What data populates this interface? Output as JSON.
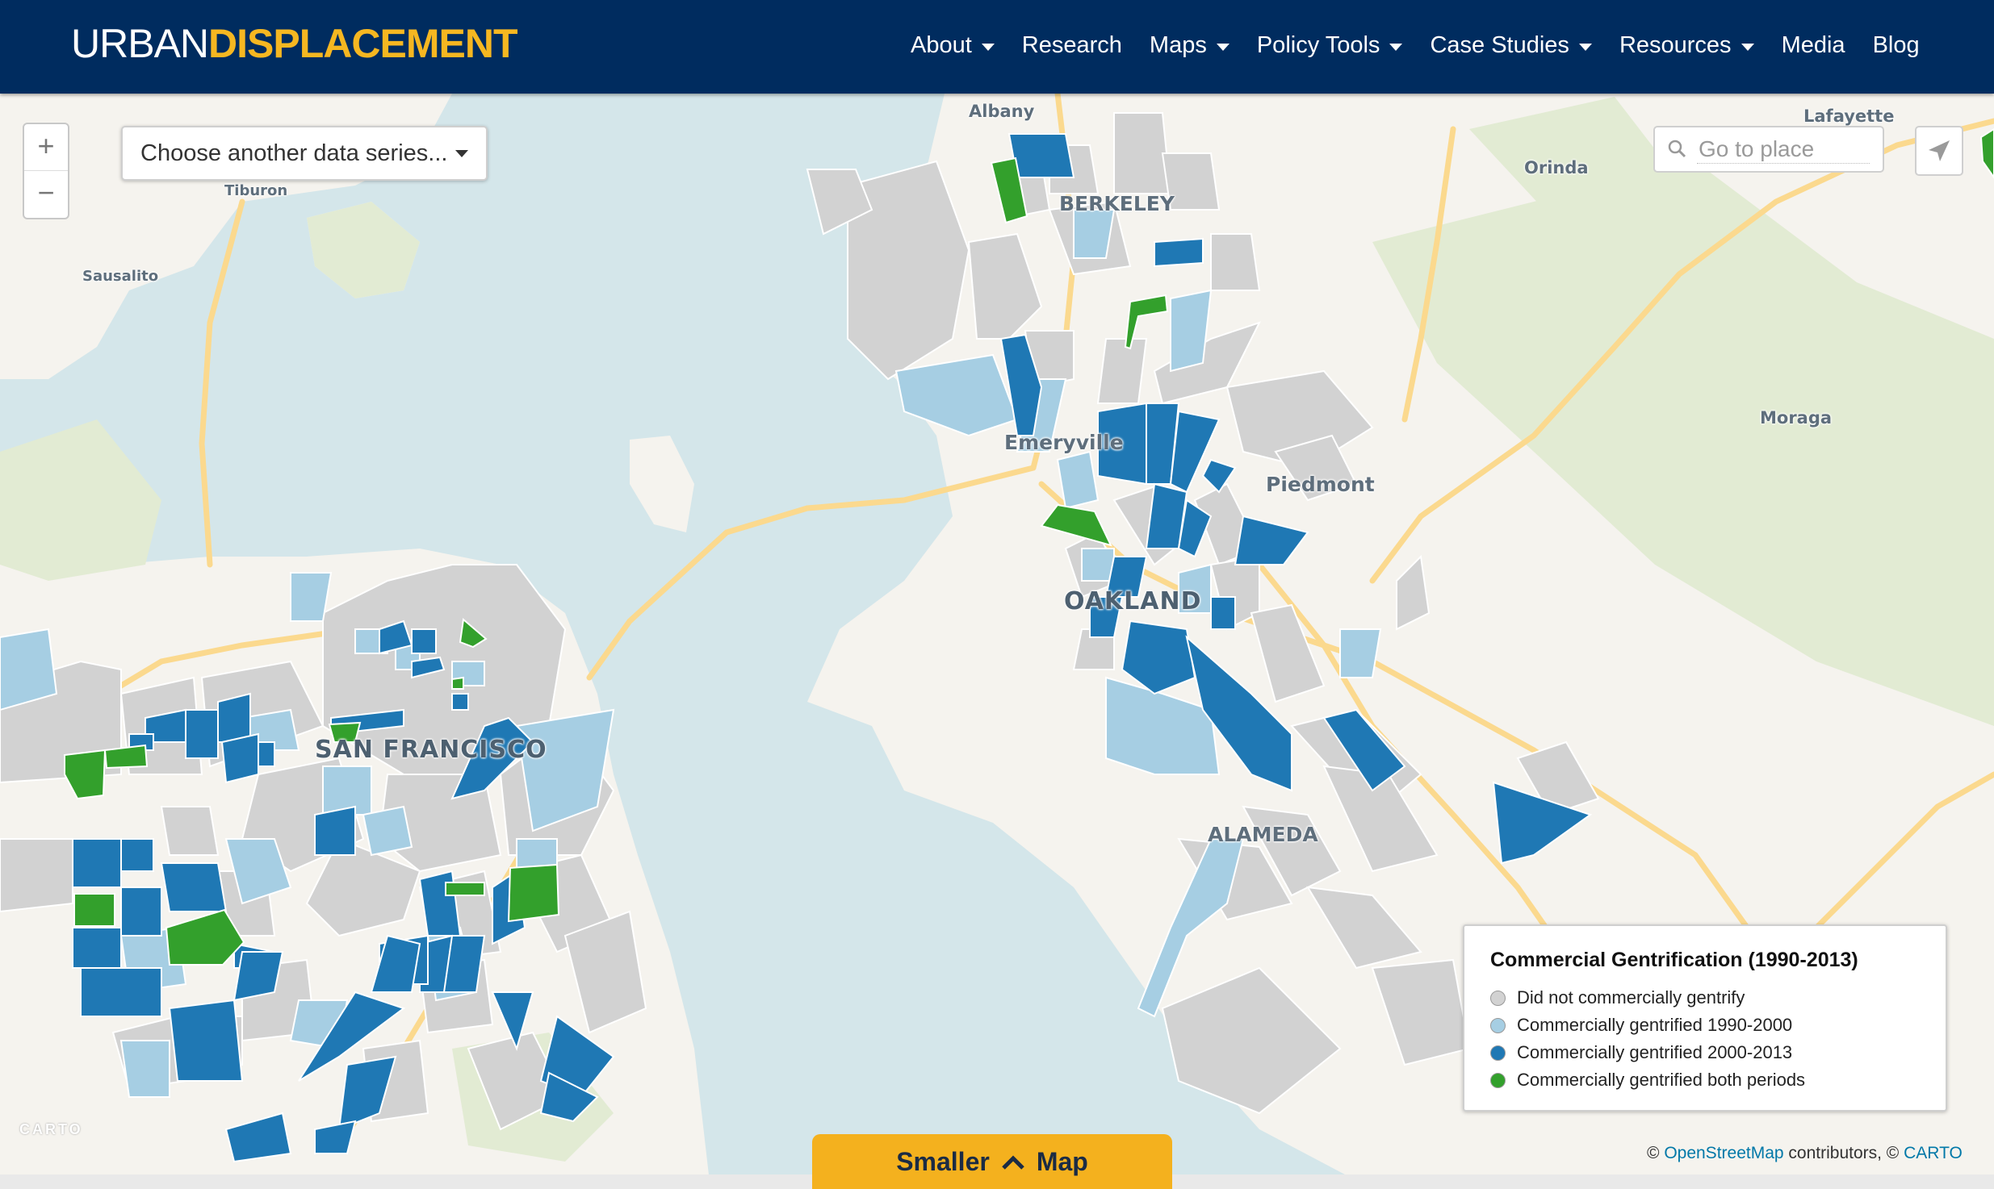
{
  "header": {
    "logo_part1": "URBAN",
    "logo_part2": "DISPLACEMENT",
    "nav": [
      {
        "label": "About",
        "dropdown": true
      },
      {
        "label": "Research",
        "dropdown": false
      },
      {
        "label": "Maps",
        "dropdown": true
      },
      {
        "label": "Policy Tools",
        "dropdown": true
      },
      {
        "label": "Case Studies",
        "dropdown": true
      },
      {
        "label": "Resources",
        "dropdown": true
      },
      {
        "label": "Media",
        "dropdown": false
      },
      {
        "label": "Blog",
        "dropdown": false
      }
    ]
  },
  "map": {
    "series_select": "Choose another data series...",
    "search_placeholder": "Go to place",
    "zoom_in": "+",
    "zoom_out": "−",
    "places": {
      "san_francisco": "SAN FRANCISCO",
      "oakland": "OAKLAND",
      "berkeley": "BERKELEY",
      "alameda": "ALAMEDA",
      "emeryville": "Emeryville",
      "piedmont": "Piedmont",
      "albany": "Albany",
      "orinda": "Orinda",
      "lafayette": "Lafayette",
      "moraga": "Moraga",
      "tiburon": "Tiburon",
      "sausalito": "Sausalito"
    },
    "carto_logo": "CARTO"
  },
  "legend": {
    "title": "Commercial Gentrification (1990-2013)",
    "items": [
      {
        "label": "Did not commercially gentrify",
        "color": "#d2d2d2"
      },
      {
        "label": "Commercially gentrified 1990-2000",
        "color": "#a6cee3"
      },
      {
        "label": "Commercially gentrified 2000-2013",
        "color": "#1f78b4"
      },
      {
        "label": "Commercially gentrified both periods",
        "color": "#33a02c"
      }
    ]
  },
  "attribution": {
    "prefix": "© ",
    "osm": "OpenStreetMap",
    "middle": " contributors, © ",
    "carto": "CARTO"
  },
  "toggle": {
    "left": "Smaller",
    "right": "Map"
  },
  "colors": {
    "header_bg": "#002c5f",
    "accent": "#f6b721",
    "water": "#d4e6ea",
    "land": "#f5f3ee",
    "park": "#e3ecd6",
    "roads": "#fbd98e"
  }
}
